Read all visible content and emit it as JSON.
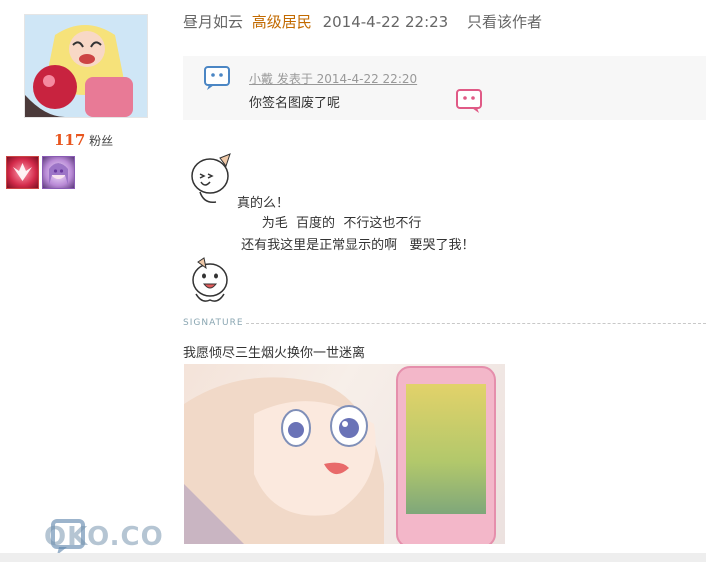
{
  "user": {
    "fans_count": "117",
    "fans_label": "粉丝"
  },
  "post_header": {
    "author": "昼月如云",
    "level": "高级居民",
    "datetime": "2014-4-22 22:23",
    "only_author": "只看该作者"
  },
  "quote": {
    "meta": "小戴 发表于 2014-4-22 22:20",
    "text": "你签名图废了呢"
  },
  "body": {
    "line1": "真的么！",
    "line2": "      为毛  百度的  不行这也不行",
    "line3": " 还有我这里是正常显示的啊   要哭了我！"
  },
  "signature": {
    "label": "SIGNATURE",
    "text": "我愿倾尽三生烟火换你一世迷离"
  },
  "watermark": {
    "text": "OKO.CO"
  },
  "colors": {
    "level": "#c26a00",
    "fans_number": "#e8551e",
    "signature_label": "#8aa6b2"
  }
}
